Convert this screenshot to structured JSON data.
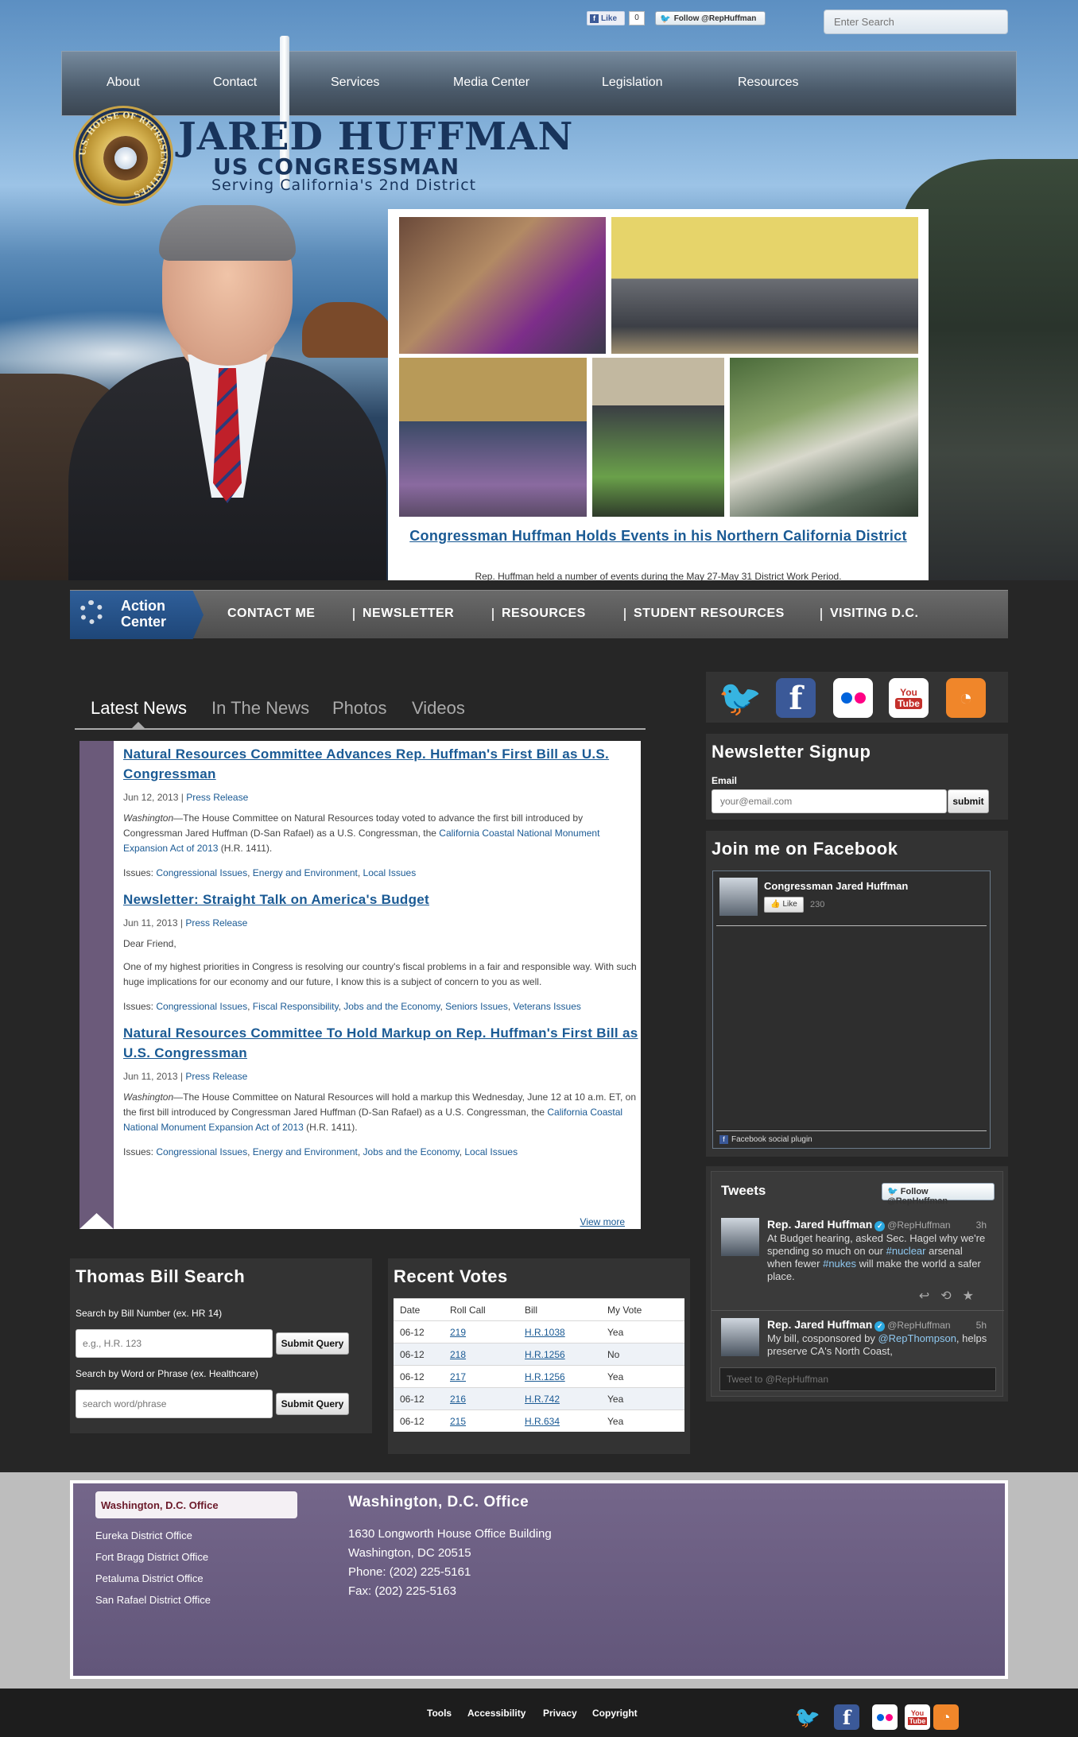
{
  "topbar": {
    "fb_like_label": "Like",
    "fb_like_count": "0",
    "twitter_follow_label": "Follow @RepHuffman",
    "search_placeholder": "Enter Search"
  },
  "main_nav": [
    "About",
    "Contact",
    "Services",
    "Media Center",
    "Legislation",
    "Resources"
  ],
  "logo": {
    "seal_text": "U.S. HOUSE OF REPRESENTATIVES",
    "name": "JARED HUFFMAN",
    "title": "US CONGRESSMAN",
    "subtitle": "Serving California's 2nd District"
  },
  "slideshow": {
    "title": "Congressman Huffman Holds Events in his Northern California District",
    "caption": "Rep. Huffman held a number of events during the May 27-May 31 District Work Period."
  },
  "action_bar": {
    "center_label": [
      "Action",
      "Center"
    ],
    "links": [
      "CONTACT ME",
      "NEWSLETTER",
      "RESOURCES",
      "STUDENT RESOURCES",
      "VISITING D.C."
    ]
  },
  "news": {
    "tabs": [
      "Latest News",
      "In The News",
      "Photos",
      "Videos"
    ],
    "items": [
      {
        "title": "Natural Resources Committee Advances Rep. Huffman's First Bill as U.S. Congressman",
        "date": "Jun 12, 2013",
        "category": "Press Release",
        "body_prefix": "Washington",
        "body": "—The House Committee on Natural Resources today voted to advance the first bill introduced by Congressman Jared Huffman (D-San Rafael) as a U.S. Congressman, the ",
        "body_link": "California Coastal National Monument Expansion Act of 2013",
        "body_suffix": " (H.R. 1411).",
        "issues_label": "Issues:",
        "issues": [
          "Congressional Issues",
          "Energy and Environment",
          "Local Issues"
        ]
      },
      {
        "title": "Newsletter: Straight Talk on America's Budget",
        "date": "Jun 11, 2013",
        "category": "Press Release",
        "greeting": "Dear Friend,",
        "body": "One of my highest priorities in Congress is resolving our country's fiscal problems in a fair and responsible way. With such huge implications for our economy and our future, I know this is a subject of concern to you as well.",
        "issues_label": "Issues:",
        "issues": [
          "Congressional Issues",
          "Fiscal Responsibility",
          "Jobs and the Economy",
          "Seniors Issues",
          "Veterans Issues"
        ]
      },
      {
        "title": "Natural Resources Committee To Hold Markup on Rep. Huffman's First Bill as U.S. Congressman",
        "date": "Jun 11, 2013",
        "category": "Press Release",
        "body_prefix": "Washington",
        "body": "—The House Committee on Natural Resources will hold a markup this Wednesday, June 12 at 10 a.m. ET, on the first bill introduced by Congressman Jared Huffman (D-San Rafael) as a U.S. Congressman, the ",
        "body_link": "California Coastal National Monument Expansion Act of 2013",
        "body_suffix": " (H.R. 1411).",
        "issues_label": "Issues:",
        "issues": [
          "Congressional Issues",
          "Energy and Environment",
          "Jobs and the Economy",
          "Local Issues"
        ]
      }
    ],
    "view_more": "View more"
  },
  "bill_search": {
    "title": "Thomas Bill Search",
    "number_label": "Search by Bill Number (ex. HR 14)",
    "number_placeholder": "e.g., H.R. 123",
    "phrase_label": "Search by Word or Phrase (ex. Healthcare)",
    "phrase_placeholder": "search word/phrase",
    "submit_label": "Submit Query"
  },
  "votes": {
    "title": "Recent Votes",
    "headers": [
      "Date",
      "Roll Call",
      "Bill",
      "My Vote"
    ],
    "rows": [
      [
        "06-12",
        "219",
        "H.R.1038",
        "Yea"
      ],
      [
        "06-12",
        "218",
        "H.R.1256",
        "No"
      ],
      [
        "06-12",
        "217",
        "H.R.1256",
        "Yea"
      ],
      [
        "06-12",
        "216",
        "H.R.742",
        "Yea"
      ],
      [
        "06-12",
        "215",
        "H.R.634",
        "Yea"
      ]
    ]
  },
  "social_icons": [
    "twitter-icon",
    "facebook-icon",
    "flickr-icon",
    "youtube-icon",
    "rss-icon"
  ],
  "newsletter": {
    "title": "Newsletter Signup",
    "email_label": "Email",
    "email_placeholder": "your@email.com",
    "submit_label": "submit"
  },
  "facebook": {
    "title": "Join me on Facebook",
    "page_name": "Congressman Jared Huffman",
    "like_label": "Like",
    "like_count": "230",
    "plugin_label": "Facebook social plugin"
  },
  "tweets": {
    "title": "Tweets",
    "follow_label": "Follow @RepHuffman",
    "items": [
      {
        "name": "Rep. Jared Huffman",
        "handle": "@RepHuffman",
        "time": "3h",
        "text_parts": [
          "At Budget hearing, asked Sec. Hagel why we're spending so much on our ",
          "#nuclear",
          " arsenal when fewer ",
          "#nukes",
          " will make the world a safer place."
        ]
      },
      {
        "name": "Rep. Jared Huffman",
        "handle": "@RepHuffman",
        "time": "5h",
        "text_parts": [
          "My bill, cosponsored by ",
          "@RepThompson",
          ", helps preserve CA's North Coast,"
        ]
      }
    ],
    "input_placeholder": "Tweet to @RepHuffman"
  },
  "offices": {
    "tabs": [
      "Washington, D.C. Office",
      "Eureka District Office",
      "Fort Bragg District Office",
      "Petaluma District Office",
      "San Rafael District Office"
    ],
    "active": {
      "title": "Washington, D.C. Office",
      "lines": [
        "1630 Longworth House Office Building",
        "Washington, DC 20515",
        "Phone: (202) 225-5161",
        "Fax: (202) 225-5163"
      ]
    }
  },
  "footer_links": [
    "Tools",
    "Accessibility",
    "Privacy",
    "Copyright"
  ],
  "colors": {
    "link_blue": "#1a5a94",
    "panel_dark": "#333333",
    "ribbon_purple": "#6b5a7a",
    "navy": "#18345c"
  }
}
